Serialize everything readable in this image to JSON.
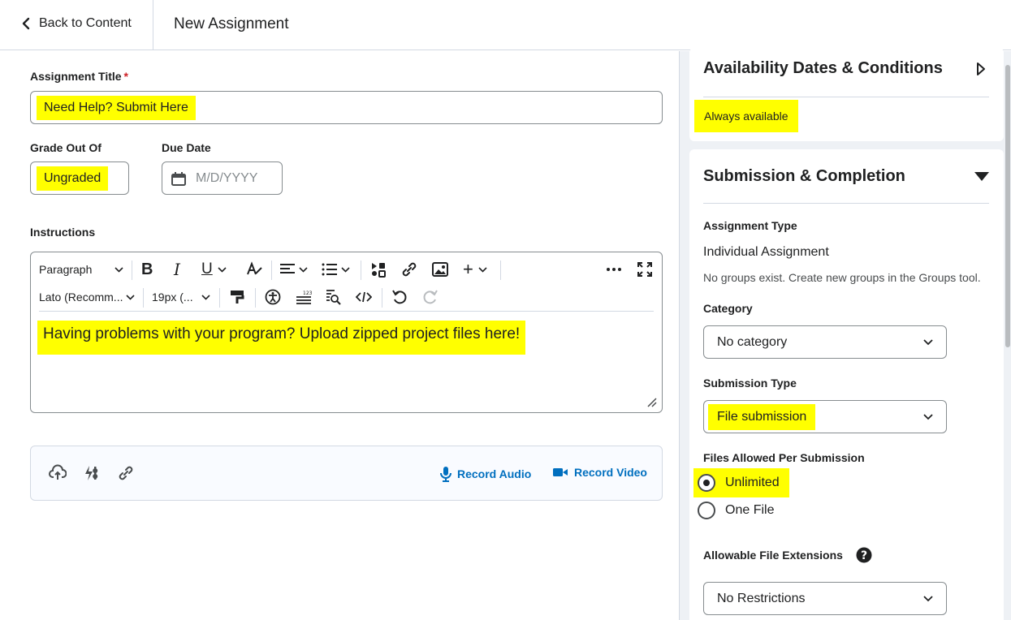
{
  "header": {
    "back_label": "Back to Content",
    "title": "New Assignment"
  },
  "form": {
    "title_label": "Assignment Title",
    "required_mark": "*",
    "title_value": "Need Help? Submit Here",
    "grade_label": "Grade Out Of",
    "grade_value": "Ungraded",
    "due_label": "Due Date",
    "due_placeholder": "M/D/YYYY",
    "instructions_label": "Instructions"
  },
  "editor": {
    "block_format": "Paragraph",
    "font_family": "Lato (Recomm...",
    "font_size": "19px (...",
    "body_text": "Having problems with your program? Upload zipped project files here!"
  },
  "attachments": {
    "record_audio": "Record Audio",
    "record_video": "Record Video"
  },
  "availability": {
    "title": "Availability Dates & Conditions",
    "status": "Always available"
  },
  "submission": {
    "title": "Submission & Completion",
    "assignment_type_label": "Assignment Type",
    "assignment_type_value": "Individual Assignment",
    "groups_note": "No groups exist. Create new groups in the Groups tool.",
    "category_label": "Category",
    "category_value": "No category",
    "submission_type_label": "Submission Type",
    "submission_type_value": "File submission",
    "files_allowed_label": "Files Allowed Per Submission",
    "files_options": [
      "Unlimited",
      "One File"
    ],
    "extensions_label": "Allowable File Extensions",
    "extensions_value": "No Restrictions"
  },
  "colors": {
    "highlight": "#ffff00",
    "link_blue": "#006fbf",
    "panel_bg": "#eef1f5"
  }
}
